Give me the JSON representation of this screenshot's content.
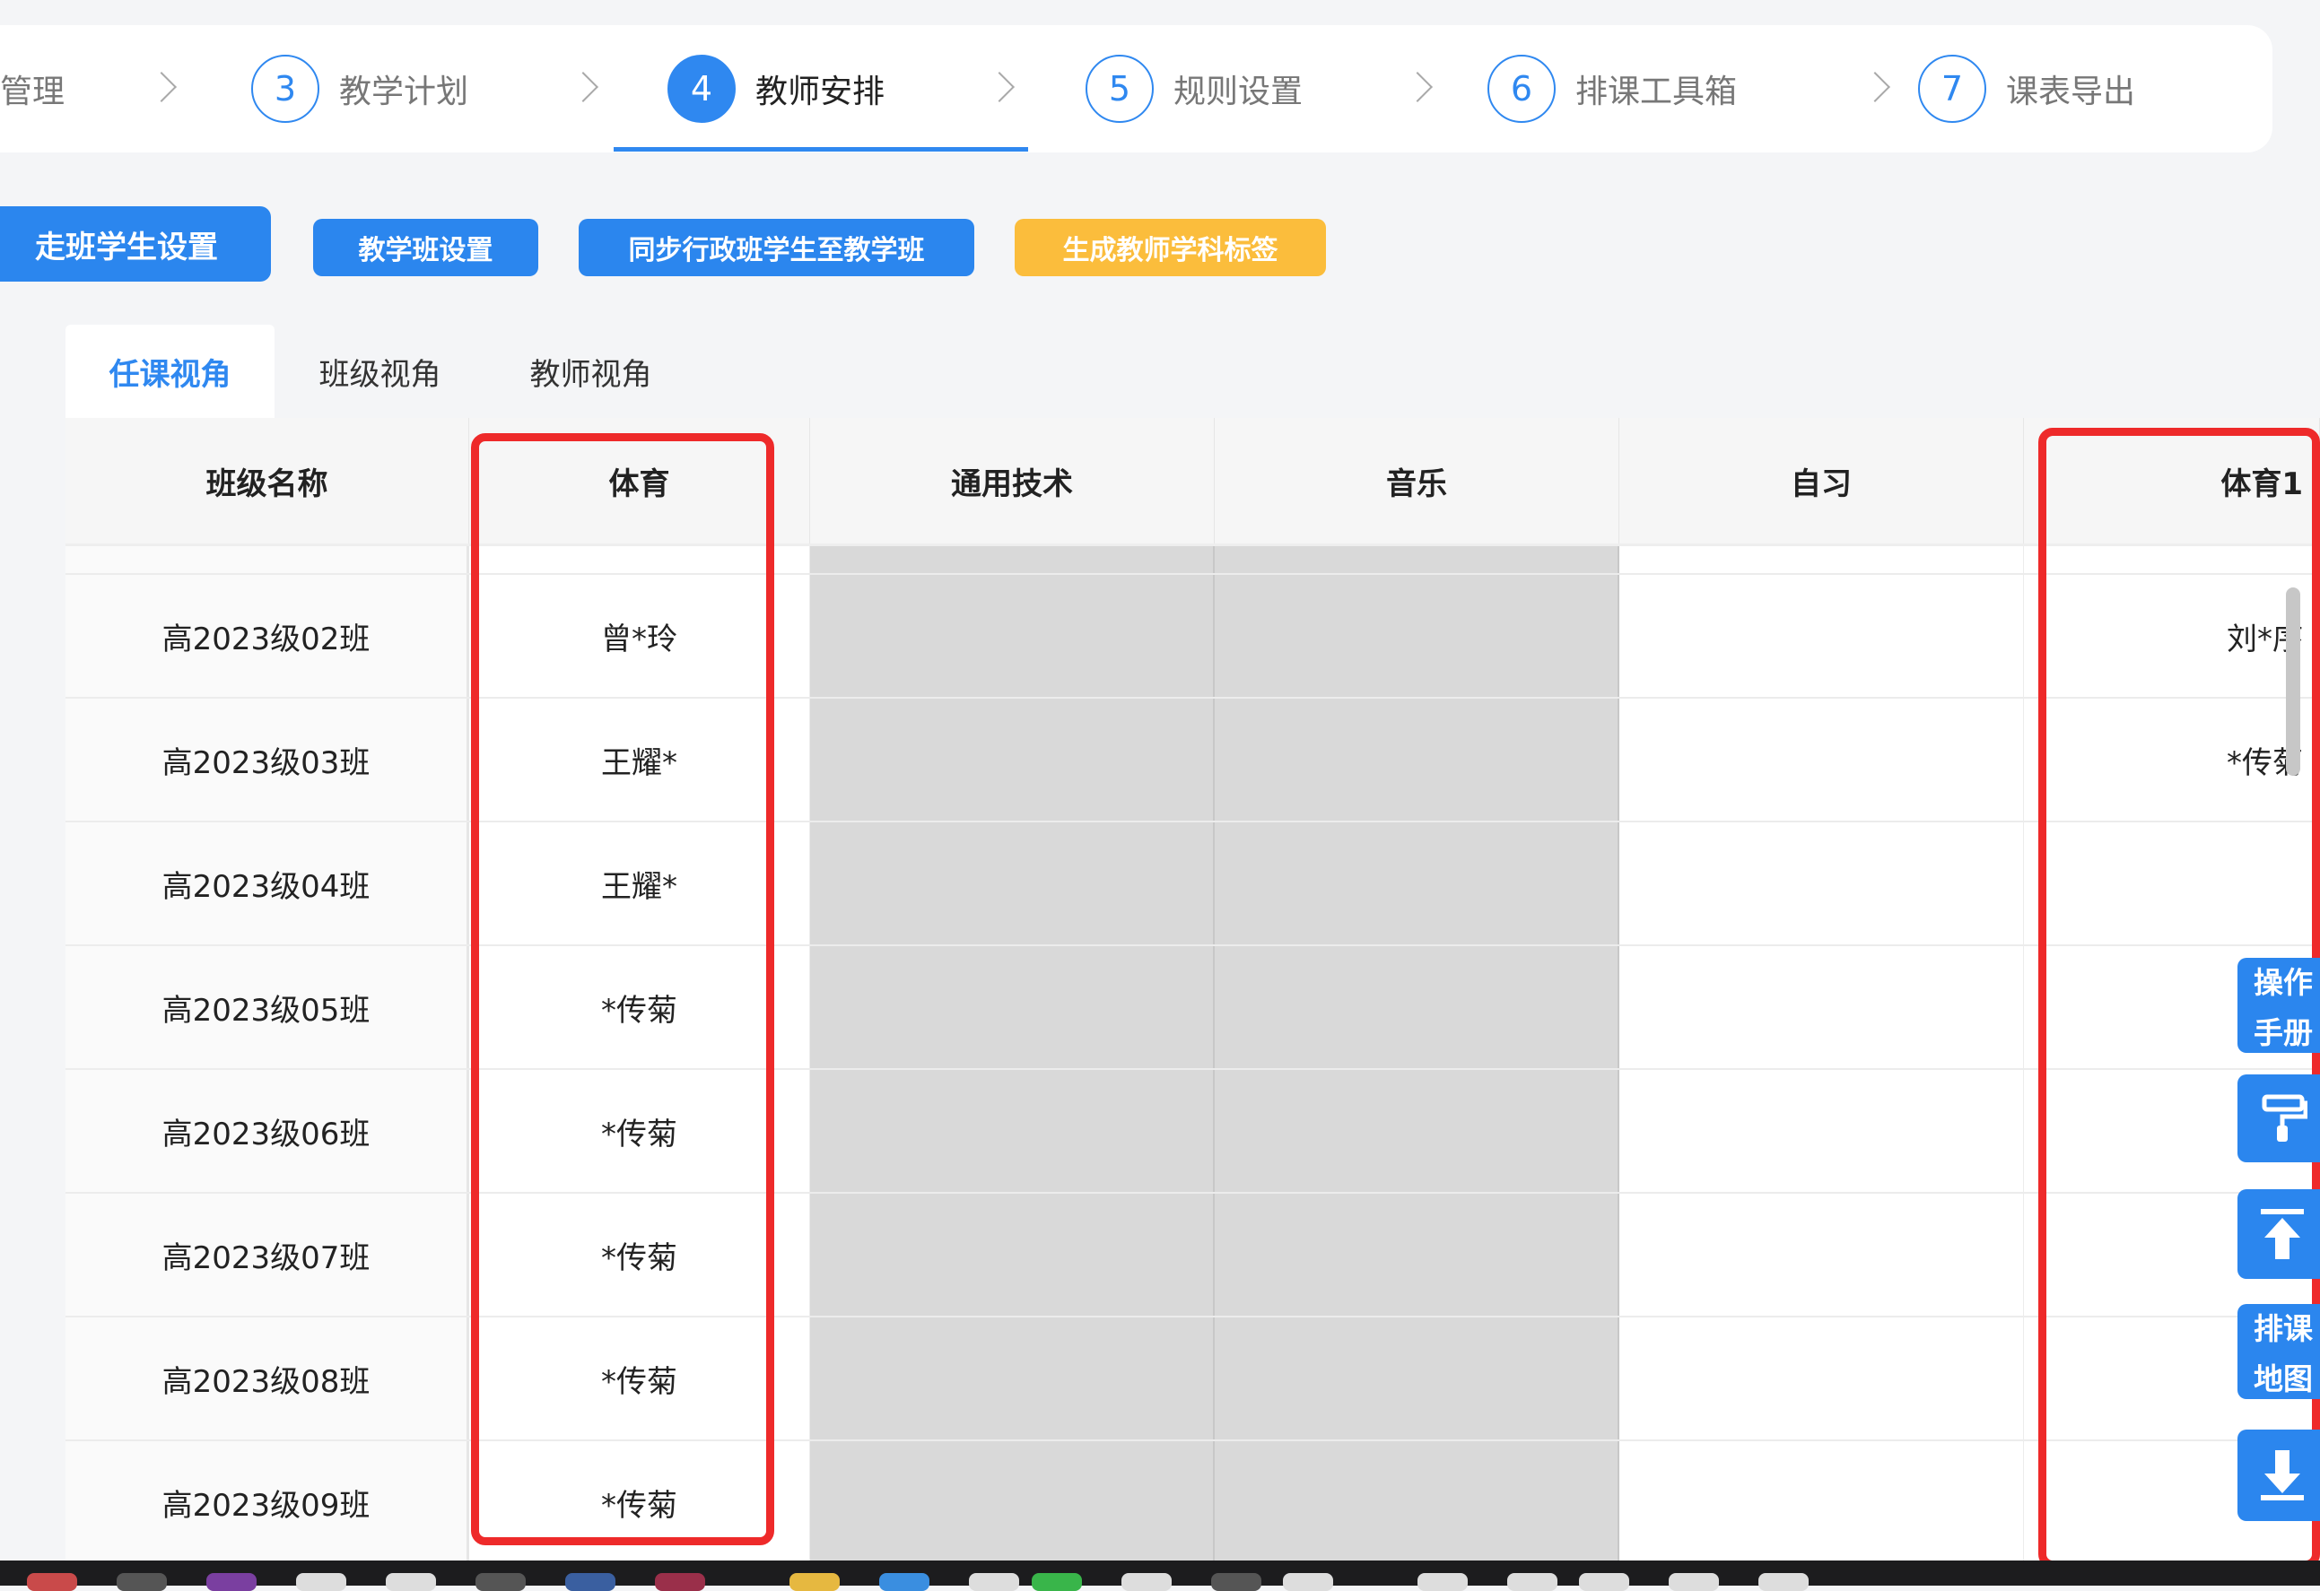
{
  "steps": [
    {
      "label": "管理",
      "number": ""
    },
    {
      "label": "教学计划",
      "number": "3"
    },
    {
      "label": "教师安排",
      "number": "4",
      "active": true
    },
    {
      "label": "规则设置",
      "number": "5"
    },
    {
      "label": "排课工具箱",
      "number": "6"
    },
    {
      "label": "课表导出",
      "number": "7"
    }
  ],
  "actions": {
    "walk_class_students": "走班学生设置",
    "teaching_class_setup": "教学班设置",
    "sync_students": "同步行政班学生至教学班",
    "generate_tags": "生成教师学科标签"
  },
  "tabs": [
    "任课视角",
    "班级视角",
    "教师视角"
  ],
  "table": {
    "columns": [
      "班级名称",
      "体育",
      "通用技术",
      "音乐",
      "自习",
      "体育1"
    ],
    "rows": [
      {
        "class": "高2023级02班",
        "pe": "曾*玲",
        "pe1": "刘*序"
      },
      {
        "class": "高2023级03班",
        "pe": "王耀*",
        "pe1": "*传菊"
      },
      {
        "class": "高2023级04班",
        "pe": "王耀*",
        "pe1": ""
      },
      {
        "class": "高2023级05班",
        "pe": "*传菊",
        "pe1": ""
      },
      {
        "class": "高2023级06班",
        "pe": "*传菊",
        "pe1": ""
      },
      {
        "class": "高2023级07班",
        "pe": "*传菊",
        "pe1": ""
      },
      {
        "class": "高2023级08班",
        "pe": "*传菊",
        "pe1": ""
      },
      {
        "class": "高2023级09班",
        "pe": "*传菊",
        "pe1": ""
      }
    ]
  },
  "float_buttons": {
    "manual": [
      "操作",
      "手册"
    ],
    "map": [
      "排课",
      "地图"
    ],
    "icons": [
      "paint-roller-icon",
      "back-to-top-icon",
      "download-icon"
    ]
  },
  "colors": {
    "primary": "#2b86ee",
    "warning": "#fbbd3c",
    "highlight": "#ee2a2a",
    "disabled_cell": "#d9d9d9"
  }
}
